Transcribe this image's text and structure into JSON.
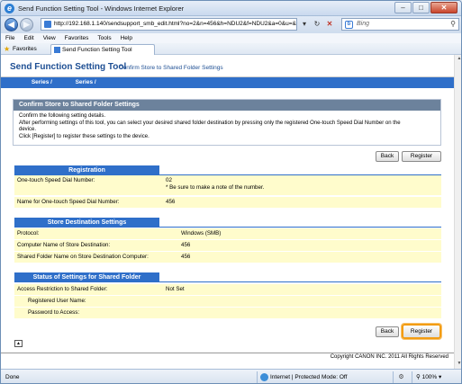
{
  "window": {
    "title": "Send Function Setting Tool - Windows Internet Explorer",
    "address": "http://192.168.1.140/sendsupport_smb_edit.html?no=2&n=456&h=NDU2&f=NDU2&a=0&u=&",
    "search_placeholder": "Bing"
  },
  "menu": [
    "File",
    "Edit",
    "View",
    "Favorites",
    "Tools",
    "Help"
  ],
  "favorites_bar": {
    "favorites_label": "Favorites",
    "tab_label": "Send Function Setting Tool"
  },
  "app": {
    "title": "Send Function Setting Tool",
    "subtitle": "Confirm Store to Shared Folder Settings",
    "series_1": "Series /",
    "series_2": "Series /"
  },
  "confirm": {
    "title": "Confirm Store to Shared Folder Settings",
    "line1": "Confirm the following setting details.",
    "line2": "After performing settings of this tool, you can select your desired shared folder destination by pressing only the registered One-touch Speed Dial Number on the",
    "line3": "device.",
    "line4": "Click [Register] to register these settings to the device."
  },
  "buttons": {
    "back": "Back",
    "register": "Register"
  },
  "registration": {
    "heading": "Registration",
    "speed_dial_label": "One-touch Speed Dial Number:",
    "speed_dial_value": "02",
    "speed_dial_note": "* Be sure to make a note of the number.",
    "name_label": "Name for One-touch Speed Dial Number:",
    "name_value": "456"
  },
  "store_destination": {
    "heading": "Store Destination Settings",
    "protocol_label": "Protocol:",
    "protocol_value": "Windows (SMB)",
    "computer_label": "Computer Name of Store Destination:",
    "computer_value": "456",
    "folder_label": "Shared Folder Name on Store Destination Computer:",
    "folder_value": "456"
  },
  "status_shared": {
    "heading": "Status of Settings for Shared Folder",
    "access_label": "Access Restriction to Shared Folder:",
    "access_value": "Not Set",
    "user_label": "Registered User Name:",
    "password_label": "Password to Access:"
  },
  "footer": {
    "copyright": "Copyright CANON INC. 2011 All Rights Reserved"
  },
  "statusbar": {
    "done": "Done",
    "zone": "Internet | Protected Mode: Off",
    "zoom": "100%"
  }
}
